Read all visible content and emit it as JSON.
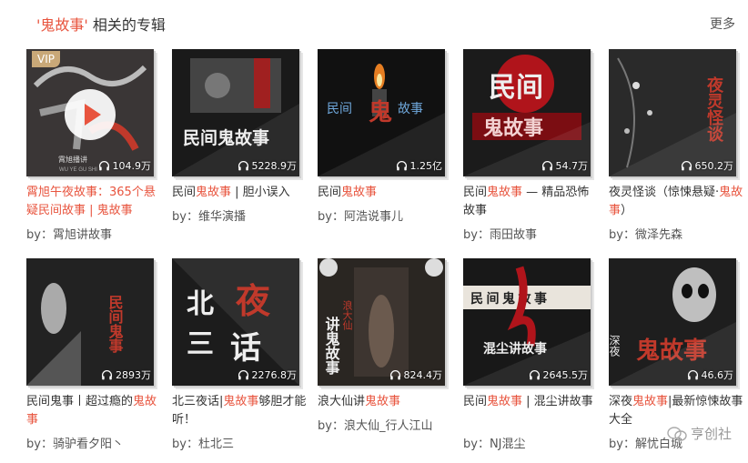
{
  "header": {
    "title_prefix": "'鬼故事'",
    "title_suffix": "相关的专辑",
    "more_label": "更多"
  },
  "colors": {
    "accent": "#e8543e",
    "vip": "#c9a878"
  },
  "albums": [
    {
      "title_parts": [
        "霄旭午夜故事：365个悬疑民间故事 | 鬼故事"
      ],
      "title_highlight": "",
      "plays": "104.9万",
      "author": "by：霄旭讲故事",
      "vip": "VIP",
      "cover_text": [
        "霄旭播讲",
        "WU YE GU SHI"
      ],
      "icon": "headphones-icon"
    },
    {
      "title_parts": [
        "民间",
        "鬼故事",
        " | 胆小误入"
      ],
      "plays": "5228.9万",
      "author": "by：维华演播",
      "cover_text": [
        "民间鬼故事"
      ]
    },
    {
      "title_parts": [
        "民间",
        "鬼故事",
        ""
      ],
      "plays": "1.25亿",
      "author": "by：阿浩说事儿",
      "cover_text": [
        "民间",
        "鬼",
        "故事"
      ]
    },
    {
      "title_parts": [
        "民间",
        "鬼故事",
        " — 精品恐怖故事"
      ],
      "plays": "54.7万",
      "author": "by：雨田故事",
      "cover_text": [
        "民间",
        "鬼故事"
      ]
    },
    {
      "title_parts": [
        "夜灵怪谈（惊悚悬疑·",
        "鬼故事",
        "）"
      ],
      "plays": "650.2万",
      "author": "by：微泽先森",
      "cover_text": [
        "夜灵怪谈"
      ]
    },
    {
      "title_parts": [
        "民间鬼事丨超过瘾的",
        "鬼故事",
        ""
      ],
      "plays": "2893万",
      "author": "by：骑驴看夕阳丶",
      "cover_text": [
        "民间鬼事"
      ]
    },
    {
      "title_parts": [
        "北三夜话|",
        "鬼故事",
        "够胆才能听！"
      ],
      "plays": "2276.8万",
      "author": "by：杜北三",
      "cover_text": [
        "北",
        "夜",
        "三",
        "话"
      ]
    },
    {
      "title_parts": [
        "浪大仙讲",
        "鬼故事",
        ""
      ],
      "plays": "824.4万",
      "author": "by：浪大仙_行人江山",
      "cover_text": [
        "讲鬼故事",
        "浪大仙"
      ]
    },
    {
      "title_parts": [
        "民间",
        "鬼故事",
        " | 混尘讲故事"
      ],
      "plays": "2645.5万",
      "author": "by：NJ混尘",
      "cover_text": [
        "民 间 鬼 故 事",
        "混尘讲故事"
      ]
    },
    {
      "title_parts": [
        "深夜",
        "鬼故事",
        "|最新惊悚故事大全"
      ],
      "plays": "46.6万",
      "author": "by：解忧白城",
      "cover_text": [
        "深夜",
        "鬼故事"
      ]
    }
  ],
  "watermark": {
    "label": "亨创社"
  }
}
